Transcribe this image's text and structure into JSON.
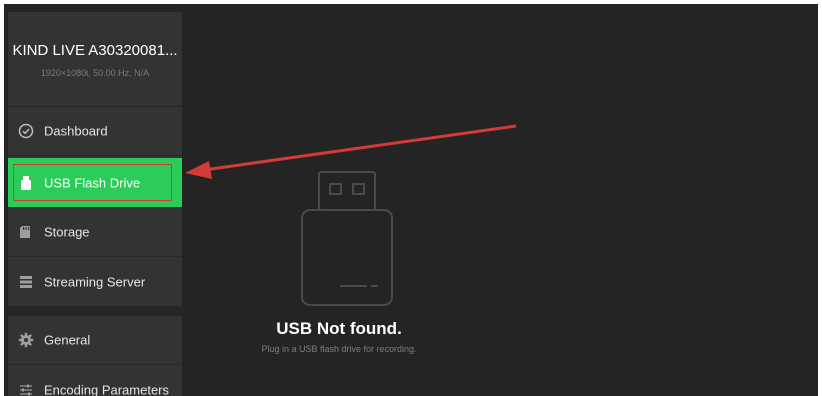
{
  "device": {
    "name": "KIND LIVE A30320081...",
    "info": "1920×1080i, 50.00 Hz, N/A"
  },
  "nav": {
    "items": [
      {
        "label": "Dashboard",
        "icon": "dashboard-icon"
      },
      {
        "label": "USB Flash Drive",
        "icon": "usb-drive-icon",
        "active": true
      },
      {
        "label": "Storage",
        "icon": "sd-card-icon"
      },
      {
        "label": "Streaming Server",
        "icon": "server-icon"
      },
      {
        "label": "General",
        "icon": "gear-icon"
      },
      {
        "label": "Encoding Parameters",
        "icon": "sliders-icon"
      }
    ]
  },
  "empty_state": {
    "title": "USB Not found.",
    "subtitle": "Plug in a USB flash drive for recording.",
    "icon": "usb-stick-icon"
  },
  "colors": {
    "active": "#2ccc5a",
    "sidebar": "#333333",
    "background": "#242424",
    "annotation_arrow": "#d23b36"
  }
}
